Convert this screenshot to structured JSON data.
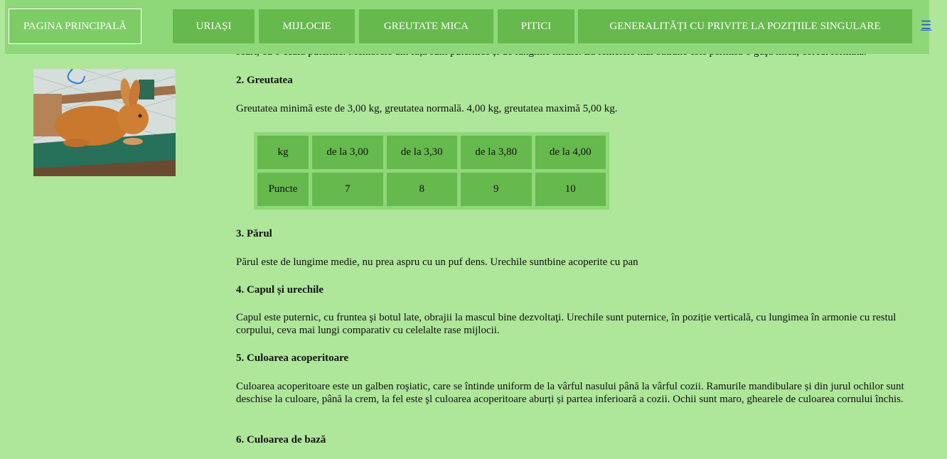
{
  "nav": {
    "home": "PAGINA PRINCIPALĂ",
    "items": [
      "URIAȘI",
      "MIJLOCIE",
      "GREUTATE MICA",
      "PITICI",
      "GENERALITĂȚI CU PRIVITE LA POZIȚIILE SINGULARE"
    ],
    "menu_icon": "☰"
  },
  "article": {
    "clipped_line": "scurt, cu o ceafă puternic. Membrele din față sunt puternice și de lungime medie. La femelele mai bătrâne este permisă o guşă mică, corect formată.",
    "s2_title": "2. Greutatea",
    "s2_text": "Greutatea minimă este de 3,00 kg, greutatea normală. 4,00 kg, greutatea maximă 5,00 kg.",
    "s3_title": "3. Părul",
    "s3_text": "Părul este de lungime medie, nu prea aspru cu un puf dens. Urechile suntbine acoperite cu pan",
    "s4_title": "4. Capul și urechile",
    "s4_text": "Capul este puternic, cu fruntea şi botul late, obrajii la mascul bine dezvoltaţi. Urechile sunt puternice, în poziție verticală, cu lungimea în armonie cu restul corpului, ceva mai lungi comparativ cu celelalte rase mijlocii.",
    "s5_title": "5. Culoarea acoperitoare",
    "s5_text": "Culoarea acoperitoare este un galben roşiatic, care se întinde uniform de la vârful nasului până la vârful cozii. Ramurile mandibulare și din jurul ochilor sunt deschise la culoare, până la crem, la fel este şl culoarea acoperitoare aburți și partea inferioară a cozii. Ochii sunt maro, ghearele de culoarea cornului închis.",
    "s6_title": "6. Culoarea de bază"
  },
  "weight_table": {
    "rows": [
      [
        "kg",
        "de la 3,00",
        "de la 3,30",
        "de la 3,80",
        "de la 4,00"
      ],
      [
        "Puncte",
        "7",
        "8",
        "9",
        "10"
      ]
    ]
  },
  "photo": {
    "icon": "rabbit-photo"
  }
}
